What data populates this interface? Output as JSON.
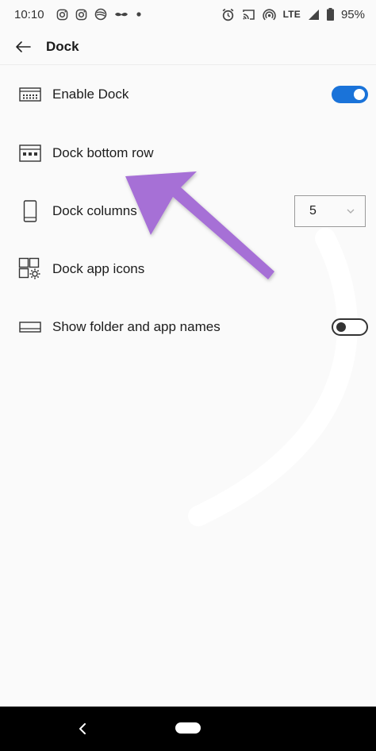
{
  "status_bar": {
    "time": "10:10",
    "left_icons": [
      "instagram-icon",
      "instagram-icon",
      "pinterest-icon",
      "mustache-icon",
      "dot-icon"
    ],
    "right_icons": [
      "alarm-icon",
      "cast-icon",
      "hotspot-icon",
      "signal-icon",
      "battery-icon"
    ],
    "network": "LTE",
    "battery": "95%"
  },
  "header": {
    "title": "Dock",
    "back_icon": "arrow-left-icon"
  },
  "settings": [
    {
      "label": "Enable Dock",
      "icon": "keyboard-icon",
      "control": "toggle",
      "state": "on"
    },
    {
      "label": "Dock bottom row",
      "icon": "dock-row-icon",
      "control": "none"
    },
    {
      "label": "Dock columns",
      "icon": "phone-icon",
      "control": "dropdown",
      "value": "5"
    },
    {
      "label": "Dock app icons",
      "icon": "grid-gear-icon",
      "control": "none"
    },
    {
      "label": "Show folder and app names",
      "icon": "dock-bar-icon",
      "control": "toggle",
      "state": "off"
    }
  ],
  "colors": {
    "accent": "#1a73d9",
    "annotation_arrow": "#a66fd6",
    "background": "#fafafa",
    "nav_bar": "#000000"
  },
  "nav_bar": {
    "back_icon": "chevron-left-icon",
    "home_icon": "home-pill-icon"
  }
}
